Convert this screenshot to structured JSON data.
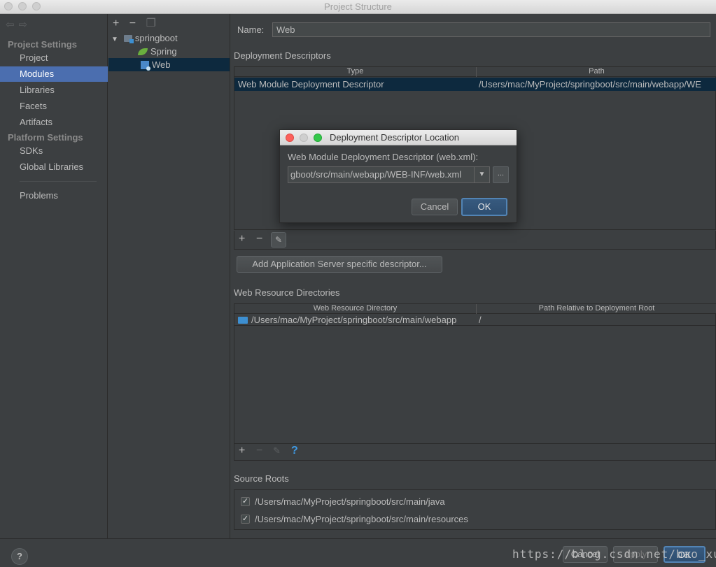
{
  "window": {
    "title": "Project Structure"
  },
  "sidebar": {
    "project_settings": "Project Settings",
    "items": [
      "Project",
      "Modules",
      "Libraries",
      "Facets",
      "Artifacts"
    ],
    "platform_settings": "Platform Settings",
    "platform_items": [
      "SDKs",
      "Global Libraries"
    ],
    "problems": "Problems"
  },
  "tree": {
    "toolbar": {
      "add": "+",
      "remove": "−"
    },
    "root": "springboot",
    "children": [
      "Spring",
      "Web"
    ]
  },
  "main": {
    "name_label": "Name:",
    "name_value": "Web",
    "deployment": {
      "title": "Deployment Descriptors",
      "columns": [
        "Type",
        "Path"
      ],
      "rows": [
        {
          "type": "Web Module Deployment Descriptor",
          "path": "/Users/mac/MyProject/springboot/src/main/webapp/WE"
        }
      ],
      "toolbar": {
        "add": "+",
        "remove": "−",
        "edit": "✎"
      },
      "add_server_button": "Add Application Server specific descriptor..."
    },
    "web_resources": {
      "title": "Web Resource Directories",
      "columns": [
        "Web Resource Directory",
        "Path Relative to Deployment Root"
      ],
      "rows": [
        {
          "directory": "/Users/mac/MyProject/springboot/src/main/webapp",
          "relative": "/"
        }
      ],
      "toolbar": {
        "add": "+",
        "remove": "−",
        "edit": "✎",
        "help": "?"
      }
    },
    "source_roots": {
      "title": "Source Roots",
      "items": [
        {
          "path": "/Users/mac/MyProject/springboot/src/main/java",
          "checked": true
        },
        {
          "path": "/Users/mac/MyProject/springboot/src/main/resources",
          "checked": true
        }
      ]
    }
  },
  "dialog": {
    "title": "Deployment Descriptor Location",
    "label": "Web Module Deployment Descriptor (web.xml):",
    "value": "gboot/src/main/webapp/WEB-INF/web.xml",
    "browse": "...",
    "cancel": "Cancel",
    "ok": "OK"
  },
  "footer": {
    "help": "?",
    "watermark": "https://blog.csdn.net/bao_xu",
    "cancel": "Cancel",
    "apply": "Apply",
    "ok": "OK"
  },
  "colors": {
    "selection": "#4b6eaf",
    "tree_selection": "#0d293e",
    "accent_help": "#3f9ae5"
  }
}
